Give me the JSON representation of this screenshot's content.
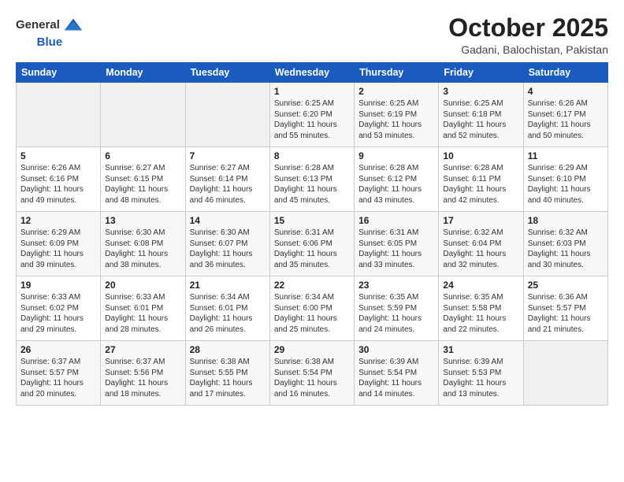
{
  "header": {
    "logo_general": "General",
    "logo_blue": "Blue",
    "title": "October 2025",
    "subtitle": "Gadani, Balochistan, Pakistan"
  },
  "days_of_week": [
    "Sunday",
    "Monday",
    "Tuesday",
    "Wednesday",
    "Thursday",
    "Friday",
    "Saturday"
  ],
  "weeks": [
    [
      {
        "day": "",
        "info": ""
      },
      {
        "day": "",
        "info": ""
      },
      {
        "day": "",
        "info": ""
      },
      {
        "day": "1",
        "info": "Sunrise: 6:25 AM\nSunset: 6:20 PM\nDaylight: 11 hours\nand 55 minutes."
      },
      {
        "day": "2",
        "info": "Sunrise: 6:25 AM\nSunset: 6:19 PM\nDaylight: 11 hours\nand 53 minutes."
      },
      {
        "day": "3",
        "info": "Sunrise: 6:25 AM\nSunset: 6:18 PM\nDaylight: 11 hours\nand 52 minutes."
      },
      {
        "day": "4",
        "info": "Sunrise: 6:26 AM\nSunset: 6:17 PM\nDaylight: 11 hours\nand 50 minutes."
      }
    ],
    [
      {
        "day": "5",
        "info": "Sunrise: 6:26 AM\nSunset: 6:16 PM\nDaylight: 11 hours\nand 49 minutes."
      },
      {
        "day": "6",
        "info": "Sunrise: 6:27 AM\nSunset: 6:15 PM\nDaylight: 11 hours\nand 48 minutes."
      },
      {
        "day": "7",
        "info": "Sunrise: 6:27 AM\nSunset: 6:14 PM\nDaylight: 11 hours\nand 46 minutes."
      },
      {
        "day": "8",
        "info": "Sunrise: 6:28 AM\nSunset: 6:13 PM\nDaylight: 11 hours\nand 45 minutes."
      },
      {
        "day": "9",
        "info": "Sunrise: 6:28 AM\nSunset: 6:12 PM\nDaylight: 11 hours\nand 43 minutes."
      },
      {
        "day": "10",
        "info": "Sunrise: 6:28 AM\nSunset: 6:11 PM\nDaylight: 11 hours\nand 42 minutes."
      },
      {
        "day": "11",
        "info": "Sunrise: 6:29 AM\nSunset: 6:10 PM\nDaylight: 11 hours\nand 40 minutes."
      }
    ],
    [
      {
        "day": "12",
        "info": "Sunrise: 6:29 AM\nSunset: 6:09 PM\nDaylight: 11 hours\nand 39 minutes."
      },
      {
        "day": "13",
        "info": "Sunrise: 6:30 AM\nSunset: 6:08 PM\nDaylight: 11 hours\nand 38 minutes."
      },
      {
        "day": "14",
        "info": "Sunrise: 6:30 AM\nSunset: 6:07 PM\nDaylight: 11 hours\nand 36 minutes."
      },
      {
        "day": "15",
        "info": "Sunrise: 6:31 AM\nSunset: 6:06 PM\nDaylight: 11 hours\nand 35 minutes."
      },
      {
        "day": "16",
        "info": "Sunrise: 6:31 AM\nSunset: 6:05 PM\nDaylight: 11 hours\nand 33 minutes."
      },
      {
        "day": "17",
        "info": "Sunrise: 6:32 AM\nSunset: 6:04 PM\nDaylight: 11 hours\nand 32 minutes."
      },
      {
        "day": "18",
        "info": "Sunrise: 6:32 AM\nSunset: 6:03 PM\nDaylight: 11 hours\nand 30 minutes."
      }
    ],
    [
      {
        "day": "19",
        "info": "Sunrise: 6:33 AM\nSunset: 6:02 PM\nDaylight: 11 hours\nand 29 minutes."
      },
      {
        "day": "20",
        "info": "Sunrise: 6:33 AM\nSunset: 6:01 PM\nDaylight: 11 hours\nand 28 minutes."
      },
      {
        "day": "21",
        "info": "Sunrise: 6:34 AM\nSunset: 6:01 PM\nDaylight: 11 hours\nand 26 minutes."
      },
      {
        "day": "22",
        "info": "Sunrise: 6:34 AM\nSunset: 6:00 PM\nDaylight: 11 hours\nand 25 minutes."
      },
      {
        "day": "23",
        "info": "Sunrise: 6:35 AM\nSunset: 5:59 PM\nDaylight: 11 hours\nand 24 minutes."
      },
      {
        "day": "24",
        "info": "Sunrise: 6:35 AM\nSunset: 5:58 PM\nDaylight: 11 hours\nand 22 minutes."
      },
      {
        "day": "25",
        "info": "Sunrise: 6:36 AM\nSunset: 5:57 PM\nDaylight: 11 hours\nand 21 minutes."
      }
    ],
    [
      {
        "day": "26",
        "info": "Sunrise: 6:37 AM\nSunset: 5:57 PM\nDaylight: 11 hours\nand 20 minutes."
      },
      {
        "day": "27",
        "info": "Sunrise: 6:37 AM\nSunset: 5:56 PM\nDaylight: 11 hours\nand 18 minutes."
      },
      {
        "day": "28",
        "info": "Sunrise: 6:38 AM\nSunset: 5:55 PM\nDaylight: 11 hours\nand 17 minutes."
      },
      {
        "day": "29",
        "info": "Sunrise: 6:38 AM\nSunset: 5:54 PM\nDaylight: 11 hours\nand 16 minutes."
      },
      {
        "day": "30",
        "info": "Sunrise: 6:39 AM\nSunset: 5:54 PM\nDaylight: 11 hours\nand 14 minutes."
      },
      {
        "day": "31",
        "info": "Sunrise: 6:39 AM\nSunset: 5:53 PM\nDaylight: 11 hours\nand 13 minutes."
      },
      {
        "day": "",
        "info": ""
      }
    ]
  ]
}
